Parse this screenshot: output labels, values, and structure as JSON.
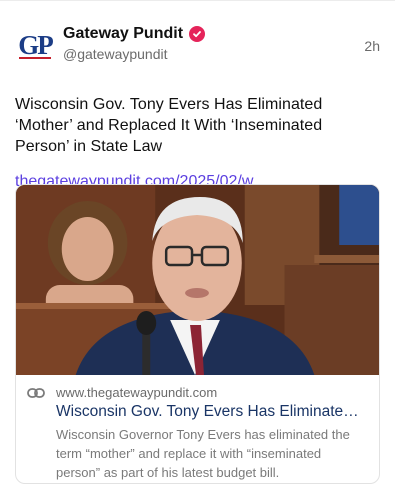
{
  "author": {
    "avatar_text": "GP",
    "display_name": "Gateway Pundit",
    "handle": "@gatewaypundit",
    "verified_icon": "verified-check-icon",
    "brand_color": "#1c3d86",
    "accent_color": "#c61f2b"
  },
  "post": {
    "time": "2h",
    "text": "Wisconsin Gov. Tony Evers Has Eliminated ‘Mother’ and Replaced It With ‘Inseminated Person’ in State Law",
    "link": "thegatewaypundit.com/2025/02/w...",
    "link_color": "#5b3fe0"
  },
  "card": {
    "icon": "link-icon",
    "domain": "www.thegatewaypundit.com",
    "title": "Wisconsin Gov. Tony Evers Has Eliminated ‘Mot...",
    "description": "Wisconsin Governor Tony Evers has eliminated the term “mother” and replace it with “inseminated person” as part of his latest budget bill."
  }
}
